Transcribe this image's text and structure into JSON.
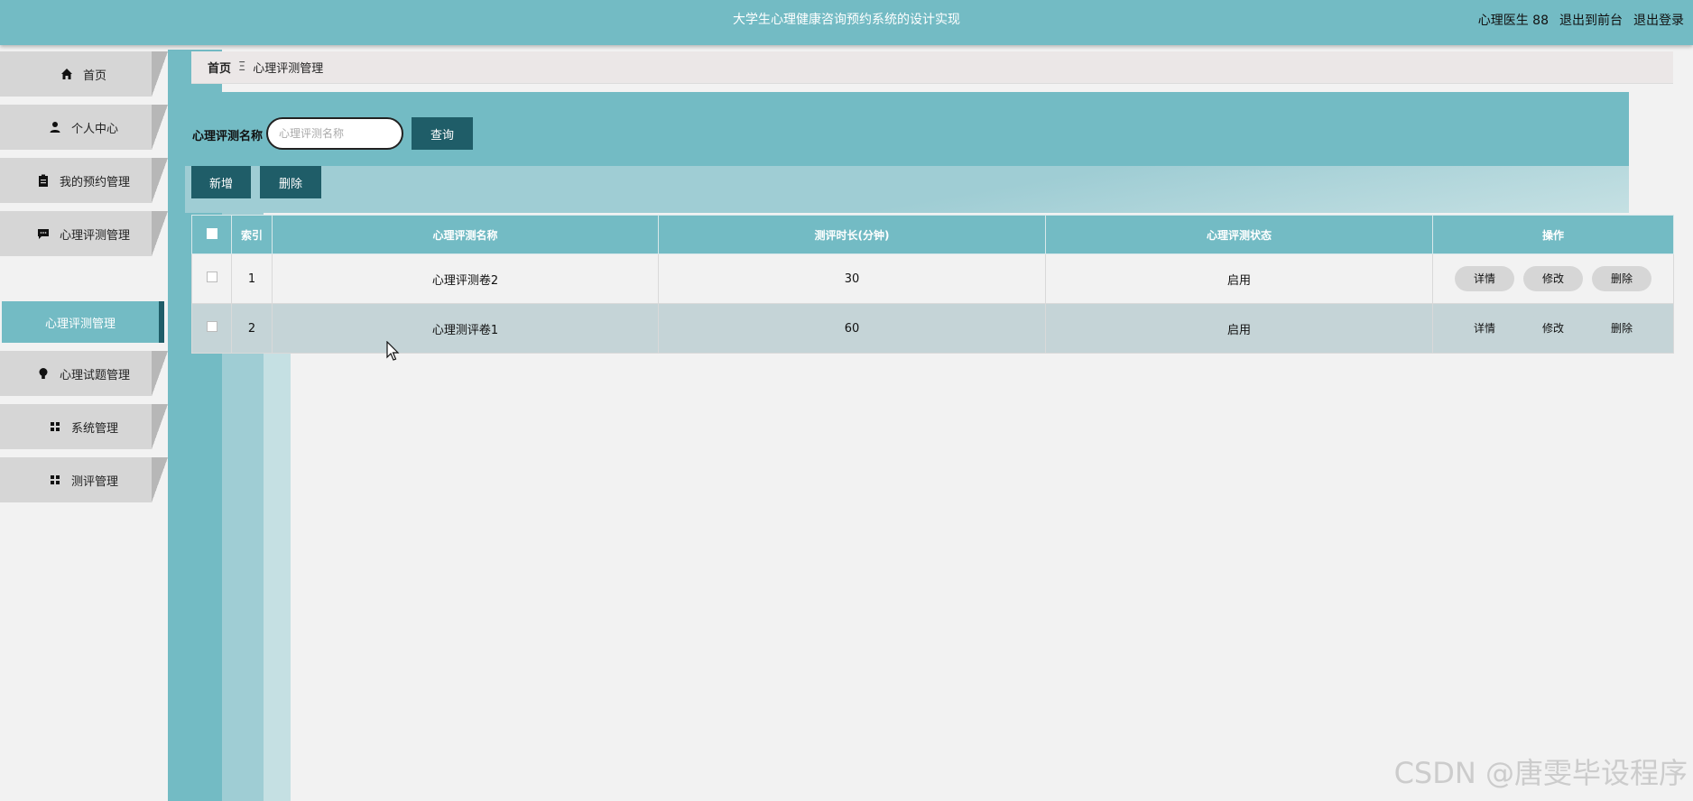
{
  "header": {
    "title": "大学生心理健康咨询预约系统的设计实现",
    "user": "心理医生 88",
    "to_front": "退出到前台",
    "logout": "退出登录"
  },
  "sidebar": {
    "items": [
      {
        "label": "首页",
        "icon": "home-icon"
      },
      {
        "label": "个人中心",
        "icon": "user-icon"
      },
      {
        "label": "我的预约管理",
        "icon": "clipboard-icon"
      },
      {
        "label": "心理评测管理",
        "icon": "chat-icon"
      },
      {
        "label": "心理试题管理",
        "icon": "bulb-icon"
      },
      {
        "label": "系统管理",
        "icon": "grid-icon"
      },
      {
        "label": "测评管理",
        "icon": "grid-icon"
      }
    ],
    "active_sub": "心理评测管理"
  },
  "breadcrumb": {
    "home": "首页",
    "sep": "Ξ",
    "current": "心理评测管理"
  },
  "search": {
    "label": "心理评测名称",
    "placeholder": "心理评测名称",
    "button": "查询"
  },
  "actions": {
    "add": "新增",
    "delete": "删除"
  },
  "table": {
    "headers": [
      "索引",
      "心理评测名称",
      "测评时长(分钟)",
      "心理评测状态",
      "操作"
    ],
    "rows": [
      {
        "index": "1",
        "name": "心理评测卷2",
        "duration": "30",
        "status": "启用"
      },
      {
        "index": "2",
        "name": "心理测评卷1",
        "duration": "60",
        "status": "启用"
      }
    ],
    "ops": {
      "detail": "详情",
      "edit": "修改",
      "delete": "删除"
    }
  },
  "watermark": "CSDN @唐雯毕设程序",
  "colors": {
    "primary": "#73bbc4",
    "dark": "#1f5d68"
  }
}
